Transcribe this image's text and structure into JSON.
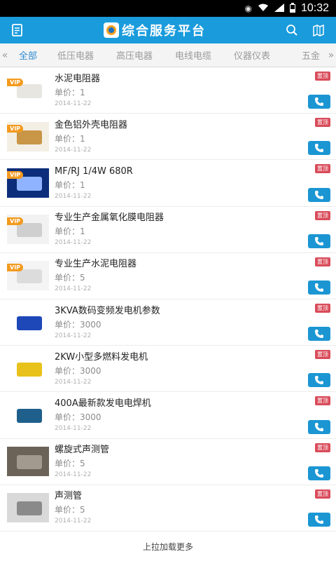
{
  "status_bar": {
    "time": "10:32"
  },
  "app_bar": {
    "title": "综合服务平台"
  },
  "tabs": {
    "left_arrow": "«",
    "right_arrow": "»",
    "items": [
      {
        "label": "全部",
        "active": true
      },
      {
        "label": "低压电器",
        "active": false
      },
      {
        "label": "高压电器",
        "active": false
      },
      {
        "label": "电线电缆",
        "active": false
      },
      {
        "label": "仪器仪表",
        "active": false
      },
      {
        "label": "五金",
        "active": false
      }
    ]
  },
  "list": {
    "vip_label": "VIP",
    "badge_label": "置顶",
    "items": [
      {
        "name": "水泥电阻器",
        "price": "单价：1",
        "date": "2014-11-22",
        "vip": true,
        "thumb_color": "#ffffff",
        "thumb_accent": "#e8e6e0"
      },
      {
        "name": "金色铝外壳电阻器",
        "price": "单价：1",
        "date": "2014-11-22",
        "vip": true,
        "thumb_color": "#f3efe4",
        "thumb_accent": "#c99546"
      },
      {
        "name": "MF/RJ 1/4W 680R",
        "price": "单价：1",
        "date": "2014-11-22",
        "vip": true,
        "thumb_color": "#0c2d7a",
        "thumb_accent": "#8fb3ff"
      },
      {
        "name": "专业生产金属氧化膜电阻器",
        "price": "单价：1",
        "date": "2014-11-22",
        "vip": true,
        "thumb_color": "#f2f2f2",
        "thumb_accent": "#cfcfcf"
      },
      {
        "name": "专业生产水泥电阻器",
        "price": "单价：5",
        "date": "2014-11-22",
        "vip": true,
        "thumb_color": "#f4f4f4",
        "thumb_accent": "#dcdcdc"
      },
      {
        "name": "3KVA数码变频发电机参数",
        "price": "单价：3000",
        "date": "2014-11-22",
        "vip": false,
        "thumb_color": "#ffffff",
        "thumb_accent": "#1e48b8"
      },
      {
        "name": "2KW小型多燃料发电机",
        "price": "单价：3000",
        "date": "2014-11-22",
        "vip": false,
        "thumb_color": "#ffffff",
        "thumb_accent": "#e8c21a"
      },
      {
        "name": "400A最新款发电电焊机",
        "price": "单价：3000",
        "date": "2014-11-22",
        "vip": false,
        "thumb_color": "#ffffff",
        "thumb_accent": "#1f5f8c"
      },
      {
        "name": "螺旋式声测管",
        "price": "单价：5",
        "date": "2014-11-22",
        "vip": false,
        "thumb_color": "#6b6358",
        "thumb_accent": "#a29a8f"
      },
      {
        "name": "声测管",
        "price": "单价：5",
        "date": "2014-11-22",
        "vip": false,
        "thumb_color": "#d9d9d9",
        "thumb_accent": "#8a8a8a"
      }
    ]
  },
  "footer": {
    "label": "上拉加载更多"
  },
  "colors": {
    "accent": "#1a9bdc",
    "badge": "#d94b5a",
    "vip": "#f39a1e"
  }
}
